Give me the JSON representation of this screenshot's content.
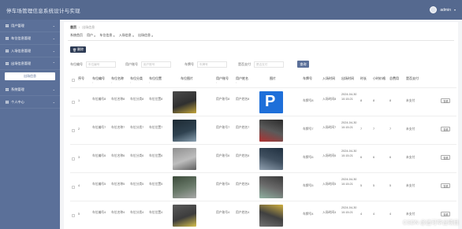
{
  "header": {
    "title": "停车场管理信息系统设计与实现",
    "user": "admin"
  },
  "sidebar": {
    "items": [
      {
        "label": "用户管理"
      },
      {
        "label": "车位信息管理"
      },
      {
        "label": "入场信息管理"
      },
      {
        "label": "出场信息管理"
      },
      {
        "label": "系统管理"
      },
      {
        "label": "个人中心"
      }
    ],
    "submenu": "出场信息"
  },
  "breadcrumb": {
    "home": "首页",
    "current": "出场信息"
  },
  "tabs": [
    "系统首页",
    "用户",
    "车位信息",
    "入场信息",
    "出场信息"
  ],
  "delete_label": "删除",
  "search": {
    "fields": [
      {
        "label": "车位编号",
        "placeholder": "车位编号"
      },
      {
        "label": "用户账号",
        "placeholder": "用户账号"
      },
      {
        "label": "车牌号",
        "placeholder": "车牌号"
      },
      {
        "label": "是否支付",
        "placeholder": "是否支付"
      }
    ],
    "button": "查询"
  },
  "table": {
    "columns": [
      {
        "label": "序号"
      },
      {
        "label": "车位编号",
        "sort": "↕"
      },
      {
        "label": "车位名称",
        "sort": "↕"
      },
      {
        "label": "车位分类",
        "sort": "↕"
      },
      {
        "label": "车位位置",
        "sort": "↕"
      },
      {
        "label": "车位图片"
      },
      {
        "label": "用户账号",
        "sort": "↕"
      },
      {
        "label": "用户姓名",
        "sort": "↕"
      },
      {
        "label": "图片"
      },
      {
        "label": "车牌号"
      },
      {
        "label": "入场时间"
      },
      {
        "label": "出场时间"
      },
      {
        "label": "时长"
      },
      {
        "label": "小时价格"
      },
      {
        "label": "总费用"
      },
      {
        "label": "是否支付"
      }
    ],
    "rows": [
      {
        "idx": "1",
        "code": "车位编号8",
        "name": "车位名称8",
        "cat": "车位分类8",
        "loc": "车位位置8",
        "user": "用户账号8",
        "uname": "用户姓名8",
        "plate": "车牌号8",
        "in": "入场时间8",
        "out": "2024-04-30 10:15:21",
        "dur": "8",
        "price": "8",
        "total": "8",
        "paid": "未支付",
        "view": "查看"
      },
      {
        "idx": "2",
        "code": "车位编号7",
        "name": "车位名称7",
        "cat": "车位分类7",
        "loc": "车位位置7",
        "user": "用户账号7",
        "uname": "用户姓名7",
        "plate": "车牌号7",
        "in": "入场时间7",
        "out": "2024-04-30 10:15:21",
        "dur": "7",
        "price": "7",
        "total": "7",
        "paid": "未支付",
        "view": "查看"
      },
      {
        "idx": "3",
        "code": "车位编号6",
        "name": "车位名称6",
        "cat": "车位分类6",
        "loc": "车位位置6",
        "user": "用户账号6",
        "uname": "用户姓名6",
        "plate": "车牌号6",
        "in": "入场时间6",
        "out": "2024-04-30 10:15:21",
        "dur": "6",
        "price": "6",
        "total": "6",
        "paid": "未支付",
        "view": "查看"
      },
      {
        "idx": "4",
        "code": "车位编号5",
        "name": "车位名称5",
        "cat": "车位分类5",
        "loc": "车位位置5",
        "user": "用户账号5",
        "uname": "用户姓名5",
        "plate": "车牌号5",
        "in": "入场时间5",
        "out": "2024-04-30 10:15:21",
        "dur": "5",
        "price": "5",
        "total": "5",
        "paid": "未支付",
        "view": "查看"
      },
      {
        "idx": "5",
        "code": "车位编号4",
        "name": "车位名称4",
        "cat": "车位分类4",
        "loc": "车位位置4",
        "user": "用户账号4",
        "uname": "用户姓名4",
        "plate": "车牌号4",
        "in": "入场时间4",
        "out": "2024-04-30 10:15:21",
        "dur": "4",
        "price": "4",
        "total": "4",
        "paid": "未支付",
        "view": "查看"
      }
    ]
  },
  "watermark": "CSDN @追可毕设项目"
}
